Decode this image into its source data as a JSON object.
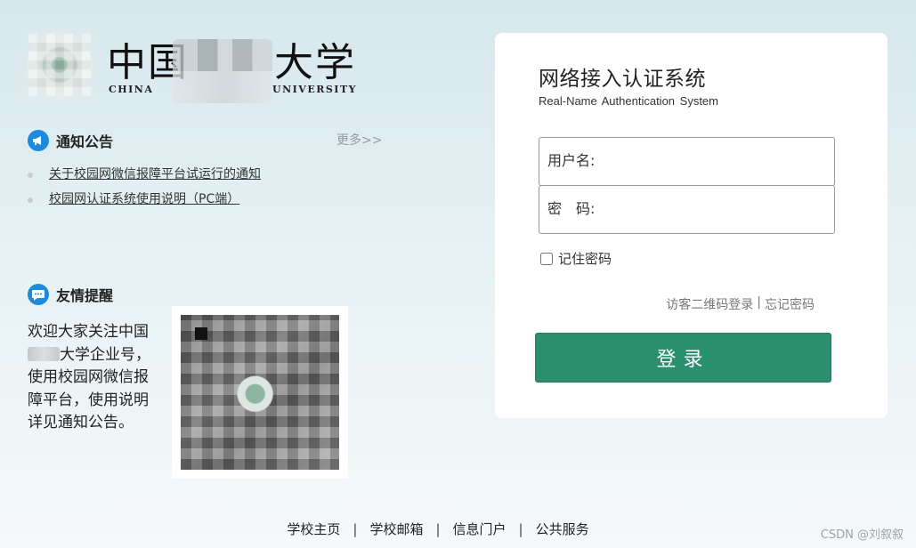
{
  "logo": {
    "cn_left": "中国",
    "cn_right": "大学",
    "en_left": "CHINA",
    "en_right": "UNIVERSITY"
  },
  "notice": {
    "title": "通知公告",
    "more": "更多>>",
    "items": [
      {
        "label": "关于校园网微信报障平台试运行的通知"
      },
      {
        "label": "校园网认证系统使用说明（PC端）"
      }
    ]
  },
  "tip": {
    "title": "友情提醒",
    "text_before": "欢迎大家关注中国",
    "text_after": "大学企业号，使用校园网微信报障平台，使用说明详见通知公告。"
  },
  "login": {
    "title": "网络接入认证系统",
    "subtitle": "Real-Name  Authentication System",
    "username_label": "用户名:",
    "password_label": "密　码:",
    "remember_label": "记住密码",
    "qr_login": "访客二维码登录",
    "link_sep": "|",
    "forgot": "忘记密码",
    "button": "登录"
  },
  "footer": {
    "links": [
      "学校主页",
      "学校邮箱",
      "信息门户",
      "公共服务"
    ],
    "sep": "|"
  },
  "watermark": "CSDN @刘叙叙",
  "colors": {
    "accent_blue": "#1c8bde",
    "login_green": "#2a8f6c"
  }
}
